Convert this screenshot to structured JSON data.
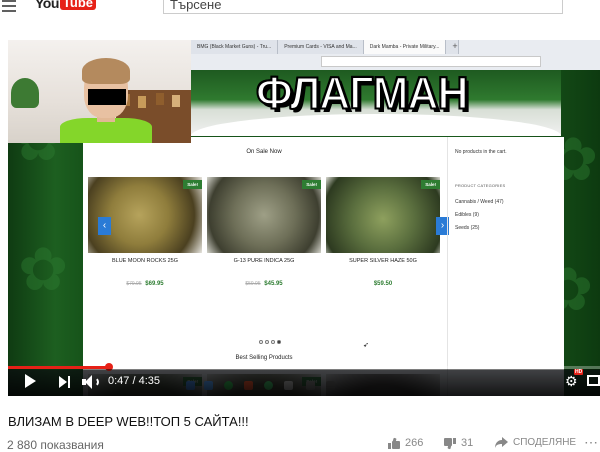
{
  "header": {
    "logo_you": "You",
    "logo_tube": "Tube",
    "logo_region": "BG",
    "search_placeholder": "Търсене"
  },
  "inner_browser": {
    "tabs": [
      {
        "label": "BMG (Black Market Guns) - Tru...",
        "active": false
      },
      {
        "label": "Premium Cards - VISA and Ma...",
        "active": false
      },
      {
        "label": "Dark Mamba - Private Military...",
        "active": true
      }
    ]
  },
  "overlay_title": "ФЛАГМАН",
  "shop": {
    "on_sale_heading": "On Sale Now",
    "best_selling_heading": "Best Selling Products",
    "sale_badge": "Sale!",
    "products": [
      {
        "name": "BLUE MOON ROCKS 25G",
        "old_price": "$79.95",
        "price": "$69.95",
        "color": "#8a7a3a"
      },
      {
        "name": "G-13 PURE INDICA 25G",
        "old_price": "$59.95",
        "price": "$45.95",
        "color": "#6e6f58"
      },
      {
        "name": "SUPER SILVER HAZE 50G",
        "old_price": "",
        "price": "$59.50",
        "color": "#5a6e3e"
      }
    ],
    "cart_text": "No products in the cart.",
    "categories_heading": "PRODUCT CATEGORIES",
    "categories": [
      {
        "label": "Cannabis / Weed (47)"
      },
      {
        "label": "Edibles (9)"
      },
      {
        "label": "Seeds (25)"
      }
    ]
  },
  "player": {
    "time_display": "0:47 / 4:35",
    "progress_fraction": 0.171,
    "hd_label": "HD",
    "accent_color": "#e62117"
  },
  "video": {
    "title": "ВЛИЗАМ В DEEP WEB!!ТОП 5 САЙТА!!!",
    "views": "2 880 показвания",
    "likes": "266",
    "dislikes": "31",
    "share_label": "СПОДЕЛЯНЕ"
  }
}
